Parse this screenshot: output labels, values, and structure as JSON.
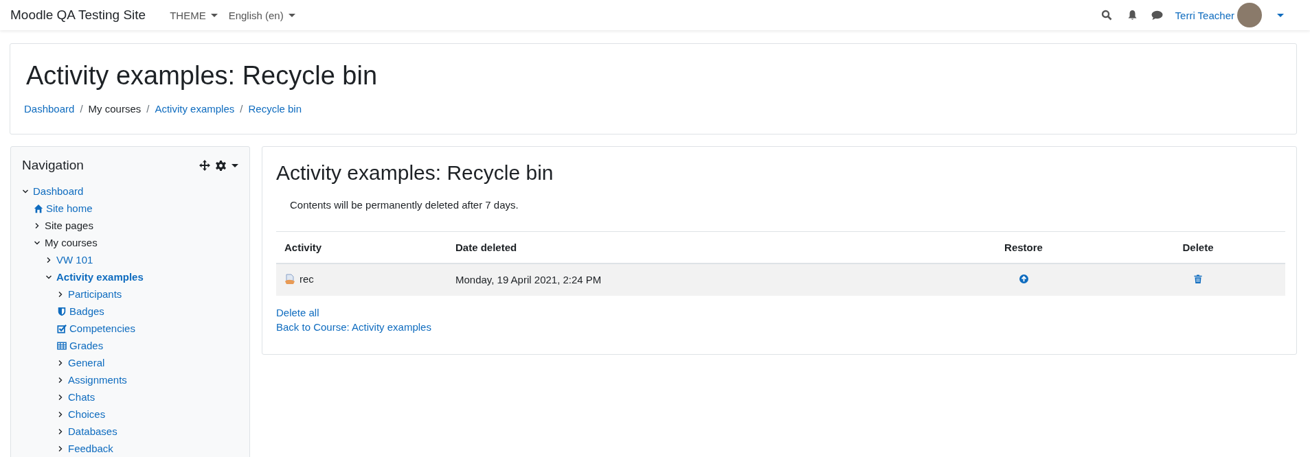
{
  "navbar": {
    "brand": "Moodle QA Testing Site",
    "menus": [
      "THEME",
      "English (en)"
    ],
    "user_name": "Terri Teacher"
  },
  "header": {
    "title": "Activity examples: Recycle bin",
    "separator": "/",
    "breadcrumbs": [
      {
        "label": "Dashboard",
        "link": true
      },
      {
        "label": "My courses",
        "link": false
      },
      {
        "label": "Activity examples",
        "link": true
      },
      {
        "label": "Recycle bin",
        "link": true
      }
    ]
  },
  "navigation": {
    "title": "Navigation",
    "tree": [
      {
        "label": "Dashboard",
        "kind": "branch",
        "expanded": true,
        "link": true,
        "selected": false,
        "children": [
          {
            "label": "Site home",
            "kind": "home",
            "link": true,
            "selected": false
          },
          {
            "label": "Site pages",
            "kind": "branch",
            "expanded": false,
            "link": false,
            "selected": false
          },
          {
            "label": "My courses",
            "kind": "branch",
            "expanded": true,
            "link": false,
            "selected": false,
            "children": [
              {
                "label": "VW 101",
                "kind": "branch",
                "expanded": false,
                "link": true,
                "selected": false
              },
              {
                "label": "Activity examples",
                "kind": "branch",
                "expanded": true,
                "link": true,
                "selected": true,
                "children": [
                  {
                    "label": "Participants",
                    "kind": "branch",
                    "expanded": false,
                    "link": true,
                    "selected": false
                  },
                  {
                    "label": "Badges",
                    "kind": "badge",
                    "link": true,
                    "selected": false
                  },
                  {
                    "label": "Competencies",
                    "kind": "checklist",
                    "link": true,
                    "selected": false
                  },
                  {
                    "label": "Grades",
                    "kind": "table",
                    "link": true,
                    "selected": false
                  },
                  {
                    "label": "General",
                    "kind": "branch",
                    "expanded": false,
                    "link": true,
                    "selected": false
                  },
                  {
                    "label": "Assignments",
                    "kind": "branch",
                    "expanded": false,
                    "link": true,
                    "selected": false
                  },
                  {
                    "label": "Chats",
                    "kind": "branch",
                    "expanded": false,
                    "link": true,
                    "selected": false
                  },
                  {
                    "label": "Choices",
                    "kind": "branch",
                    "expanded": false,
                    "link": true,
                    "selected": false
                  },
                  {
                    "label": "Databases",
                    "kind": "branch",
                    "expanded": false,
                    "link": true,
                    "selected": false
                  },
                  {
                    "label": "Feedback",
                    "kind": "branch",
                    "expanded": false,
                    "link": true,
                    "selected": false
                  }
                ]
              }
            ]
          }
        ]
      }
    ]
  },
  "main": {
    "title": "Activity examples: Recycle bin",
    "notice": "Contents will be permanently deleted after 7 days.",
    "table": {
      "columns": [
        "Activity",
        "Date deleted",
        "Restore",
        "Delete"
      ],
      "rows": [
        {
          "activity": "rec",
          "date_deleted": "Monday, 19 April 2021, 2:24 PM"
        }
      ]
    },
    "links": [
      "Delete all",
      "Back to Course: Activity examples"
    ]
  }
}
